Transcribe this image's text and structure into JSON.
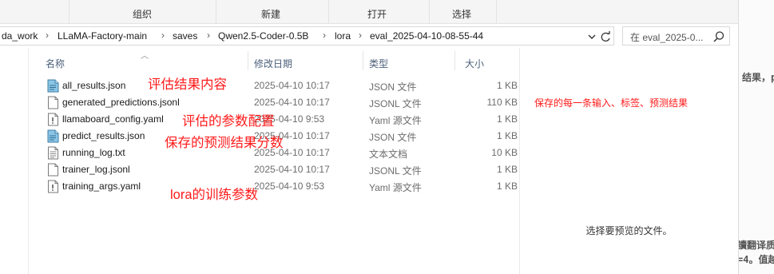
{
  "ribbon": {
    "groups": [
      "组织",
      "新建",
      "打开",
      "选择"
    ]
  },
  "address": {
    "path": [
      "da_work",
      "LLaMA-Factory-main",
      "saves",
      "Qwen2.5-Coder-0.5B",
      "lora",
      "eval_2025-04-10-08-55-44"
    ],
    "search_placeholder": "在 eval_2025-0..."
  },
  "columns": {
    "name": "名称",
    "date": "修改日期",
    "type": "类型",
    "size": "大小"
  },
  "files": [
    {
      "name": "all_results.json",
      "date": "2025-04-10 10:17",
      "type": "JSON 文件",
      "size": "1 KB",
      "icon": "json-file-icon"
    },
    {
      "name": "generated_predictions.jsonl",
      "date": "2025-04-10 10:17",
      "type": "JSONL 文件",
      "size": "110 KB",
      "icon": "blank-file-icon"
    },
    {
      "name": "llamaboard_config.yaml",
      "date": "2025-04-10 9:53",
      "type": "Yaml 源文件",
      "size": "1 KB",
      "icon": "yaml-file-icon"
    },
    {
      "name": "predict_results.json",
      "date": "2025-04-10 10:17",
      "type": "JSON 文件",
      "size": "1 KB",
      "icon": "json-file-icon"
    },
    {
      "name": "running_log.txt",
      "date": "2025-04-10 10:17",
      "type": "文本文档",
      "size": "10 KB",
      "icon": "text-file-icon"
    },
    {
      "name": "trainer_log.jsonl",
      "date": "2025-04-10 10:17",
      "type": "JSONL 文件",
      "size": "1 KB",
      "icon": "blank-file-icon"
    },
    {
      "name": "training_args.yaml",
      "date": "2025-04-10 9:53",
      "type": "Yaml 源文件",
      "size": "1 KB",
      "icon": "yaml-file-icon"
    }
  ],
  "annotations": {
    "all_results": "评估结果内容",
    "generated_predictions": "保存的每一条输入、标签、预测结果",
    "llamaboard_config": "评估的参数配置",
    "predict_results": "保存的预测结果分数",
    "training_args": "lora的训练参数"
  },
  "preview": {
    "message": "选择要预览的文件。"
  },
  "background_window": {
    "fragments": [
      "结果，pre",
      "讀翻译质",
      "=4。值越"
    ]
  },
  "colors": {
    "annotation": "#ff1a1a",
    "json_icon": "#5aa0c8",
    "header_text": "#4c607a"
  }
}
